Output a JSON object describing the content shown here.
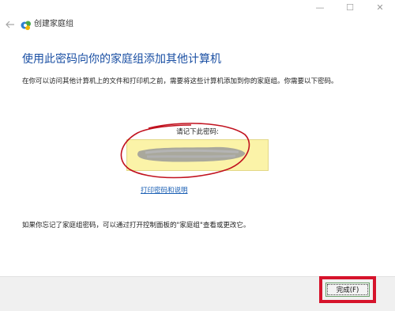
{
  "window": {
    "title": "创建家庭组",
    "controls": {
      "minimize": "—",
      "maximize": "☐",
      "close": "✕"
    }
  },
  "main": {
    "heading": "使用此密码向你的家庭组添加其他计算机",
    "intro": "在你可以访问其他计算机上的文件和打印机之前，需要将这些计算机添加到你的家庭组。你需要以下密码。",
    "password_label": "请记下此密码:",
    "print_link": "打印密码和说明",
    "forgot_text": "如果你忘记了家庭组密码，可以通过打开控制面板的\"家庭组\"查看或更改它。"
  },
  "footer": {
    "finish_label": "完成(F)"
  },
  "colors": {
    "heading": "#1a4fa3",
    "password_box": "#fbf3a8",
    "annotation_red": "#d6132b",
    "footer_bg": "#f0f0f0"
  }
}
